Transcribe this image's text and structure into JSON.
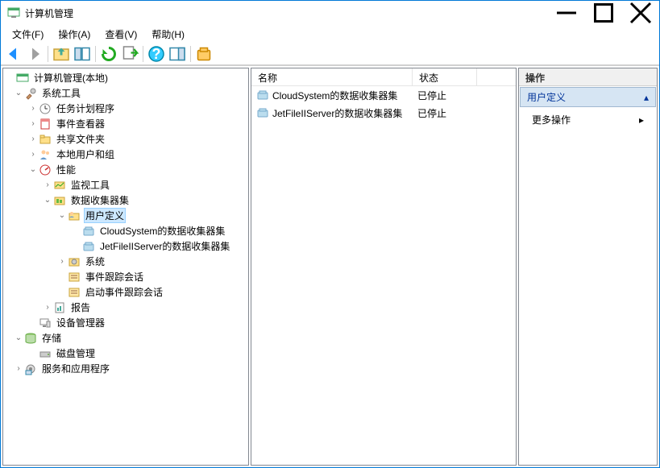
{
  "window": {
    "title": "计算机管理",
    "min": "–",
    "max": "☐",
    "close": "✕"
  },
  "menu": {
    "file": "文件(F)",
    "action": "操作(A)",
    "view": "查看(V)",
    "help": "帮助(H)"
  },
  "tree": {
    "root": "计算机管理(本地)",
    "system_tools": "系统工具",
    "task_scheduler": "任务计划程序",
    "event_viewer": "事件查看器",
    "shared_folders": "共享文件夹",
    "local_users": "本地用户和组",
    "performance": "性能",
    "monitor_tools": "监视工具",
    "data_collector_sets": "数据收集器集",
    "user_defined": "用户定义",
    "cloud_system": "CloudSystem的数据收集器集",
    "jetfile": "JetFileIIServer的数据收集器集",
    "system_node": "系统",
    "event_trace": "事件跟踪会话",
    "startup_trace": "启动事件跟踪会话",
    "reports": "报告",
    "device_manager": "设备管理器",
    "storage": "存储",
    "disk_mgmt": "磁盘管理",
    "services_apps": "服务和应用程序"
  },
  "list": {
    "col_name": "名称",
    "col_status": "状态",
    "rows": [
      {
        "name": "CloudSystem的数据收集器集",
        "status": "已停止"
      },
      {
        "name": "JetFileIIServer的数据收集器集",
        "status": "已停止"
      }
    ]
  },
  "actions": {
    "header": "操作",
    "section": "用户定义",
    "more": "更多操作"
  }
}
